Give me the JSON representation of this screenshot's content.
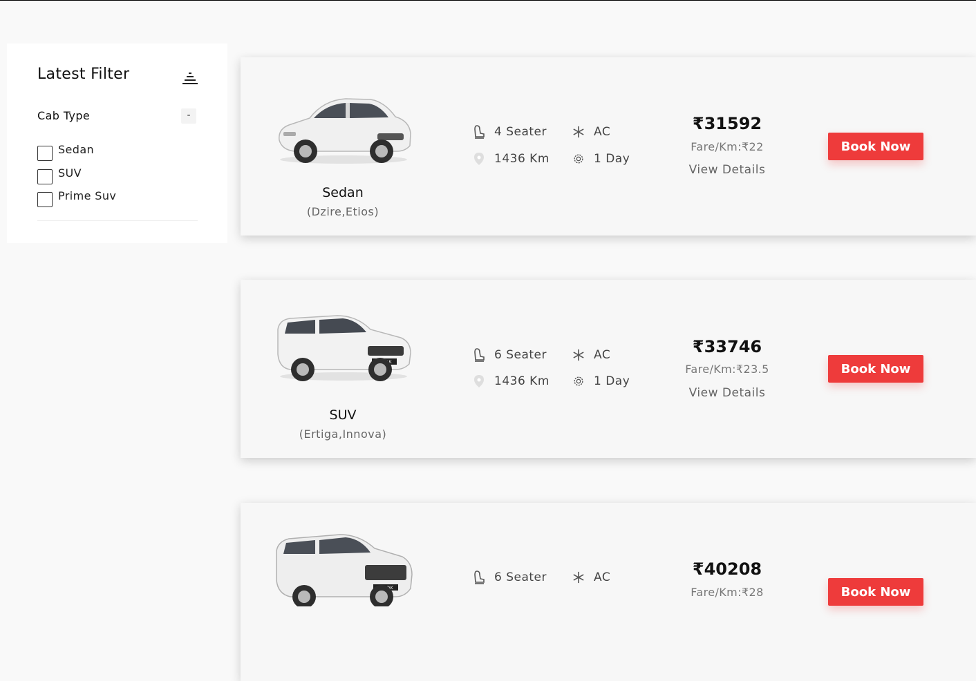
{
  "sidebar": {
    "title": "Latest Filter",
    "section_title": "Cab Type",
    "collapse_symbol": "-",
    "options": [
      "Sedan",
      "SUV",
      "Prime Suv"
    ]
  },
  "cabs": [
    {
      "name": "Sedan",
      "models": "(Dzire,Etios)",
      "seater": "4 Seater",
      "ac": "AC",
      "distance": "1436 Km",
      "days": "1 Day",
      "price": "₹31592",
      "fare": "Fare/Km:₹22",
      "details_label": "View Details",
      "book_label": "Book Now"
    },
    {
      "name": "SUV",
      "models": "(Ertiga,Innova)",
      "seater": "6 Seater",
      "ac": "AC",
      "distance": "1436 Km",
      "days": "1 Day",
      "price": "₹33746",
      "fare": "Fare/Km:₹23.5",
      "details_label": "View Details",
      "book_label": "Book Now"
    },
    {
      "seater": "6 Seater",
      "ac": "AC",
      "price": "₹40208",
      "fare": "Fare/Km:₹28",
      "book_label": "Book Now"
    }
  ],
  "icons": {
    "filter": "filter-icon",
    "seat": "seat-icon",
    "ac": "snowflake-icon",
    "distance": "location-pin-icon",
    "duration": "gear-icon"
  },
  "colors": {
    "accent": "#ee3b3b",
    "background": "#f9f9f9",
    "card": "#f7f7f7"
  }
}
